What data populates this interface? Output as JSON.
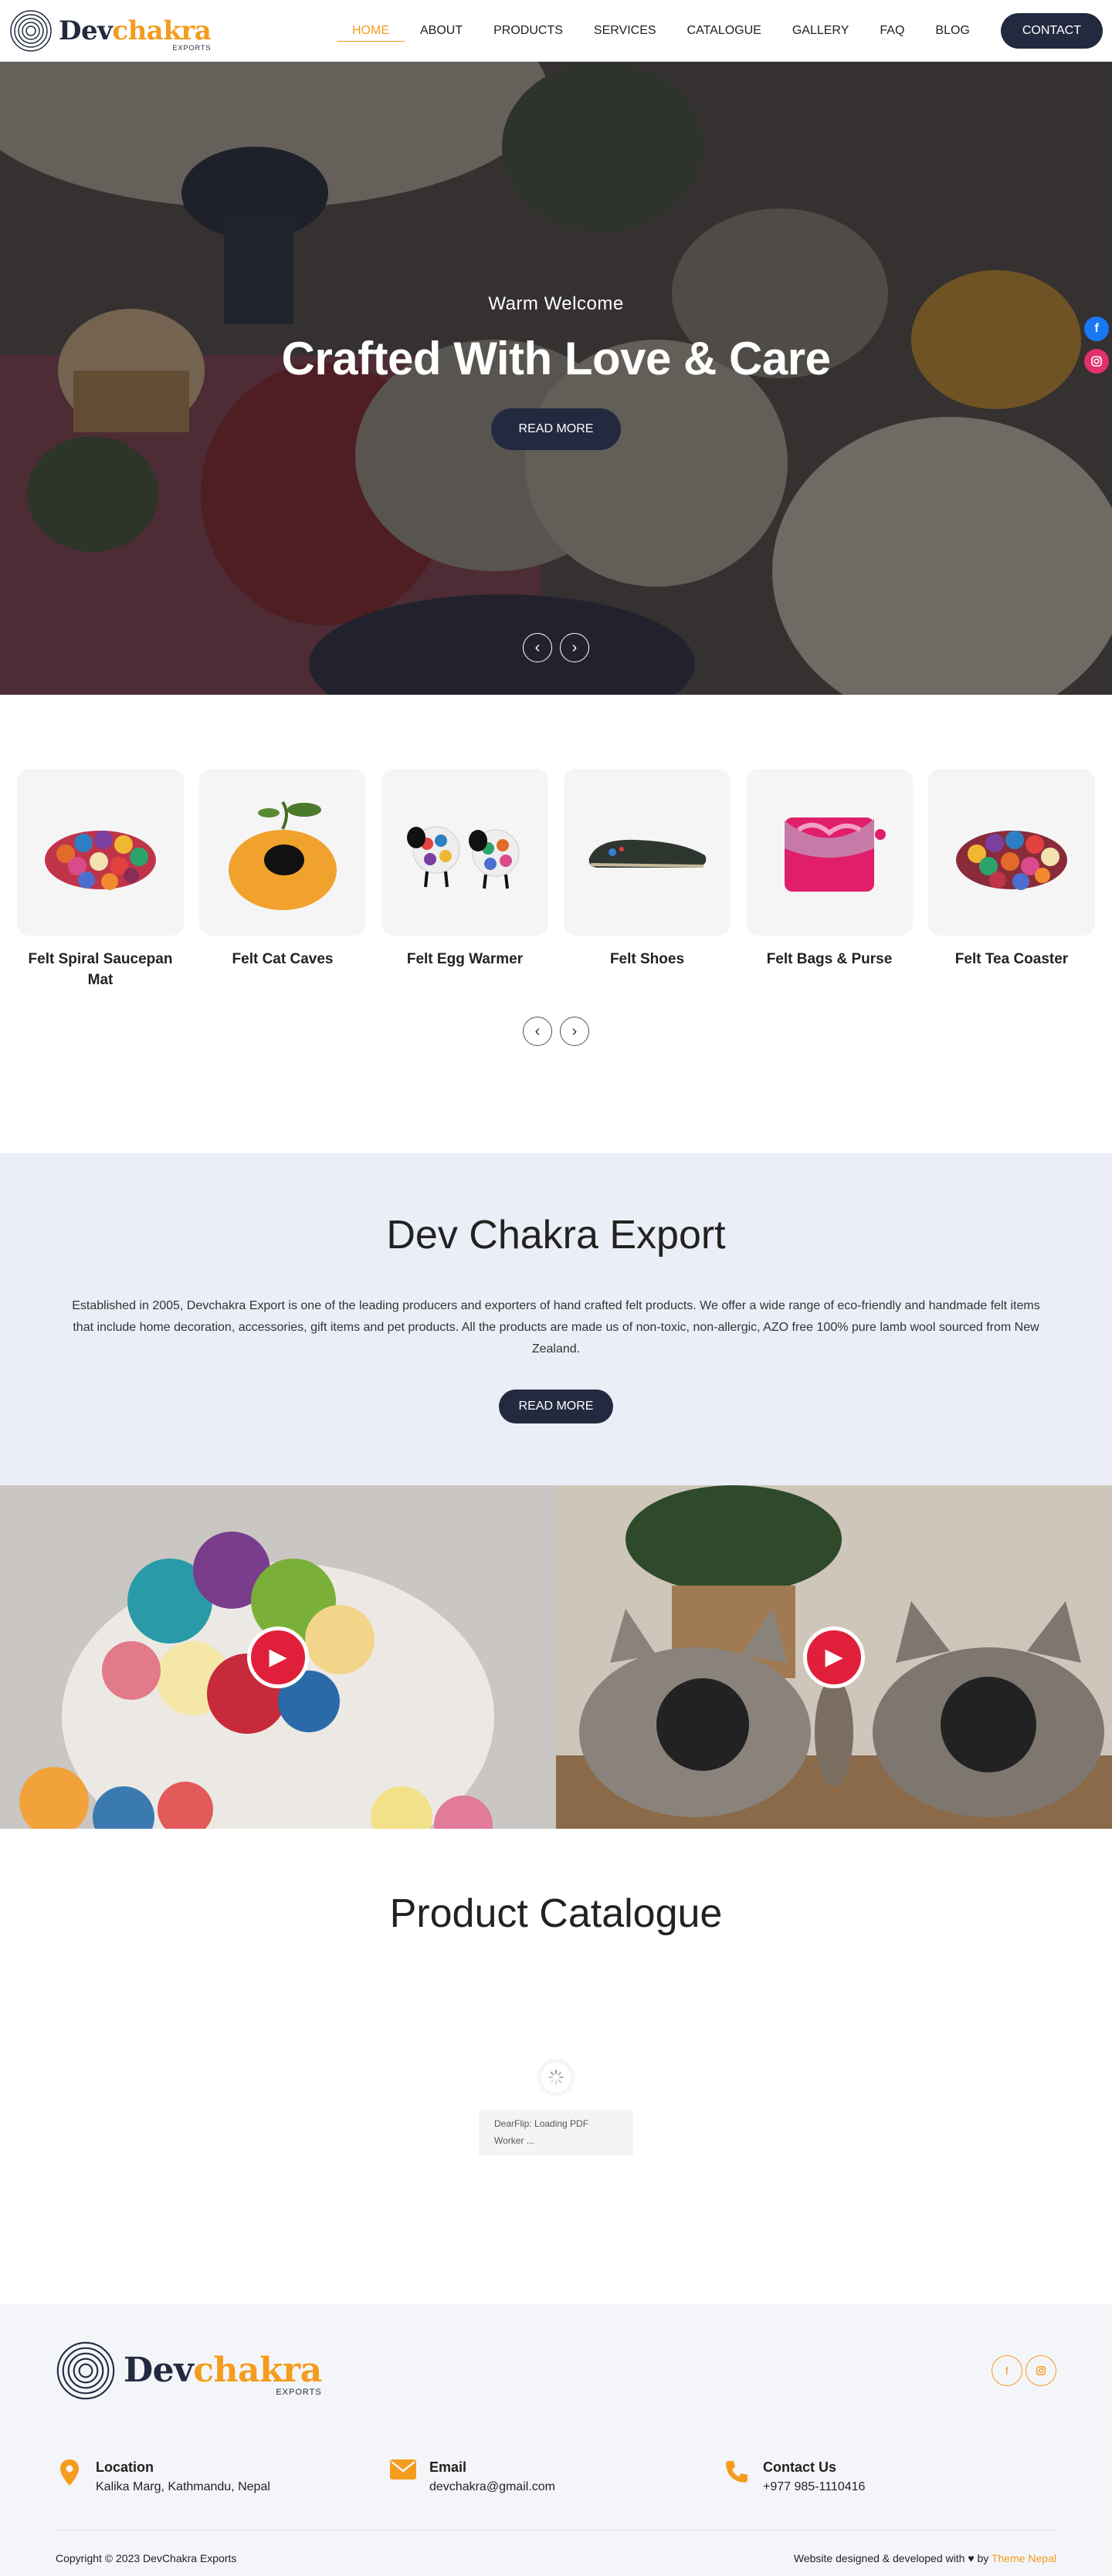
{
  "header": {
    "logo": {
      "dev": "Dev",
      "chakra": "chakra",
      "sub": "EXPORTS"
    },
    "nav": [
      "HOME",
      "ABOUT",
      "PRODUCTS",
      "SERVICES",
      "CATALOGUE",
      "GALLERY",
      "FAQ",
      "BLOG"
    ],
    "active": "HOME",
    "contact_label": "CONTACT"
  },
  "hero": {
    "kicker": "Warm Welcome",
    "headline": "Crafted With Love & Care",
    "button": "READ MORE",
    "prev_icon": "chevron-left-icon",
    "next_icon": "chevron-right-icon"
  },
  "social_float": [
    {
      "icon": "facebook-icon",
      "color": "#1877f2"
    },
    {
      "icon": "instagram-icon",
      "color": "#e1306c"
    }
  ],
  "products": {
    "items": [
      {
        "name": "Felt Spiral Saucepan Mat",
        "icon": "felt-mat-image"
      },
      {
        "name": "Felt Cat Caves",
        "icon": "cat-cave-image"
      },
      {
        "name": "Felt Egg Warmer",
        "icon": "egg-warmer-image"
      },
      {
        "name": "Felt Shoes",
        "icon": "felt-shoe-image"
      },
      {
        "name": "Felt Bags & Purse",
        "icon": "felt-bag-image"
      },
      {
        "name": "Felt Tea Coaster",
        "icon": "tea-coaster-image"
      }
    ]
  },
  "about": {
    "title": "Dev Chakra Export",
    "text": "Established in 2005, Devchakra Export is one of the leading producers and exporters of hand crafted felt products. We offer a wide range of eco-friendly and handmade felt items that include home decoration, accessories, gift items and pet products. All the products are made us of non-toxic, non-allergic, AZO free 100% pure lamb wool sourced from New Zealand.",
    "button": "READ MORE"
  },
  "videos": [
    {
      "icon": "play-icon"
    },
    {
      "icon": "play-icon"
    }
  ],
  "catalogue": {
    "title": "Product Catalogue",
    "loading": "DearFlip: Loading PDF Worker ..."
  },
  "footer": {
    "logo": {
      "dev": "Dev",
      "chakra": "chakra",
      "sub": "EXPORTS"
    },
    "social": [
      "facebook-icon",
      "instagram-icon"
    ],
    "contacts": [
      {
        "title": "Location",
        "value": "Kalika Marg, Kathmandu, Nepal",
        "icon": "map-pin-icon"
      },
      {
        "title": "Email",
        "value": "devchakra@gmail.com",
        "icon": "envelope-icon"
      },
      {
        "title": "Contact Us",
        "value": "+977 985-1110416",
        "icon": "phone-icon"
      }
    ],
    "copyright": "Copyright © 2023 DevChakra Exports",
    "credit_prefix": "Website designed & developed with",
    "credit_by": "by",
    "credit_brand": "Theme Nepal"
  },
  "colors": {
    "accent": "#f39c1e",
    "navy": "#232a40",
    "about_bg": "#ebeef7",
    "play": "#e0203a"
  }
}
